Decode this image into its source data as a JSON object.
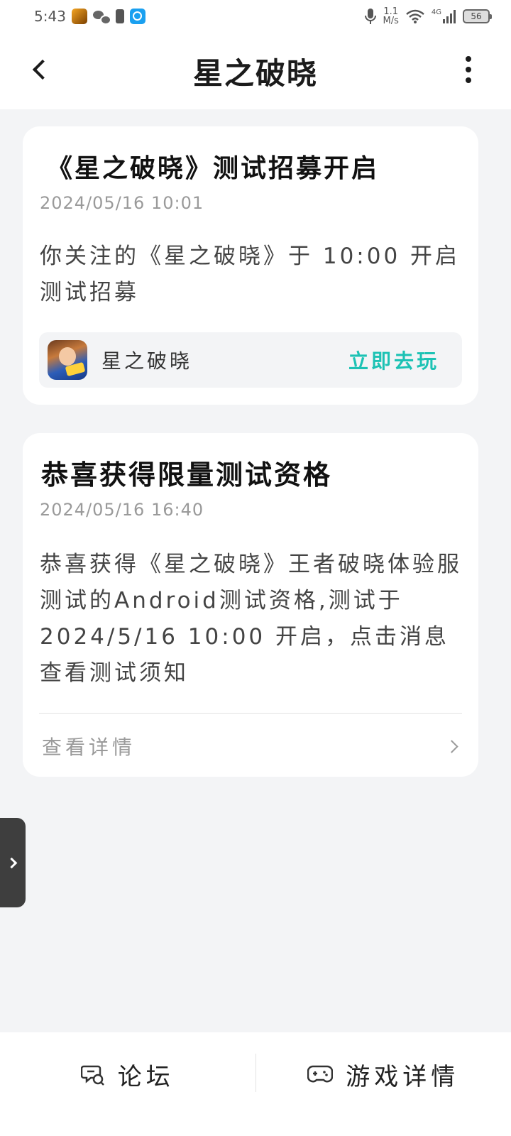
{
  "status_bar": {
    "time": "5:43",
    "net_speed_value": "1.1",
    "net_speed_unit": "M/s",
    "network_type": "4G",
    "battery": "56"
  },
  "header": {
    "title": "星之破晓"
  },
  "notifications": [
    {
      "title": "《星之破晓》测试招募开启",
      "time": "2024/05/16 10:01",
      "body": "你关注的《星之破晓》于 10:00 开启测试招募",
      "game_name": "星之破晓",
      "action_label": "立即去玩"
    },
    {
      "title": "恭喜获得限量测试资格",
      "time": "2024/05/16 16:40",
      "body": "恭喜获得《星之破晓》王者破晓体验服测试的Android测试资格,测试于2024/5/16 10:00 开启，点击消息查看测试须知",
      "details_label": "查看详情"
    }
  ],
  "bottom_bar": {
    "forum_label": "论坛",
    "game_details_label": "游戏详情"
  },
  "colors": {
    "accent": "#1cc2b4",
    "background": "#f3f4f6",
    "card": "#ffffff"
  }
}
